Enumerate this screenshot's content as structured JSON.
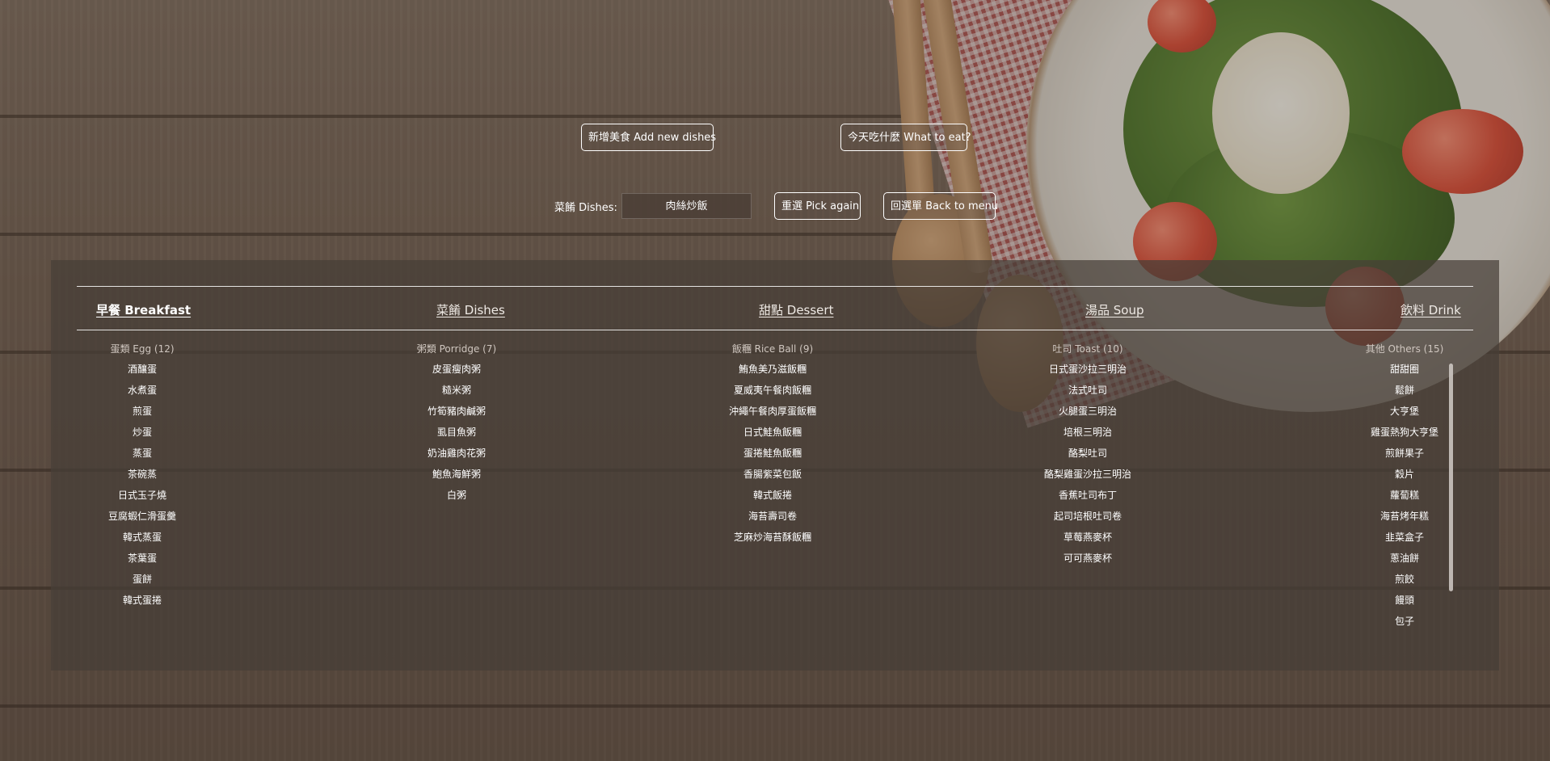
{
  "theme": {
    "accent": "#ffffff",
    "panel": "#463e38",
    "wood": "#6f5c4e"
  },
  "buttons": {
    "add_new": "新增美食 Add new dishes",
    "what_to_eat": "今天吃什麼 What to eat?",
    "pick_again": "重選 Pick again",
    "back_to_menu": "回選單 Back to menu"
  },
  "picker": {
    "label": "菜餚 Dishes:",
    "value": "肉絲炒飯"
  },
  "tabs": [
    {
      "label": "早餐 Breakfast",
      "active": true
    },
    {
      "label": "菜餚 Dishes",
      "active": false
    },
    {
      "label": "甜點 Dessert",
      "active": false
    },
    {
      "label": "湯品 Soup",
      "active": false
    },
    {
      "label": "飲料 Drink",
      "active": false
    }
  ],
  "columns": [
    {
      "header": "蛋類 Egg (12)",
      "items": [
        "酒釀蛋",
        "水煮蛋",
        "煎蛋",
        "炒蛋",
        "蒸蛋",
        "茶碗蒸",
        "日式玉子燒",
        "豆腐蝦仁滑蛋羹",
        "韓式蒸蛋",
        "茶葉蛋",
        "蛋餅",
        "韓式蛋捲"
      ]
    },
    {
      "header": "粥類 Porridge (7)",
      "items": [
        "皮蛋瘦肉粥",
        "糙米粥",
        "竹筍豬肉鹹粥",
        "虱目魚粥",
        "奶油雞肉花粥",
        "鮑魚海鮮粥",
        "白粥"
      ]
    },
    {
      "header": "飯糰 Rice Ball (9)",
      "items": [
        "鮪魚美乃滋飯糰",
        "夏威夷午餐肉飯糰",
        "沖繩午餐肉厚蛋飯糰",
        "日式鮭魚飯糰",
        "蛋捲鮭魚飯糰",
        "香腸紫菜包飯",
        "韓式飯捲",
        "海苔壽司卷",
        "芝麻炒海苔酥飯糰"
      ]
    },
    {
      "header": "吐司 Toast (10)",
      "items": [
        "日式蛋沙拉三明治",
        "法式吐司",
        "火腿蛋三明治",
        "培根三明治",
        "酪梨吐司",
        "酪梨雞蛋沙拉三明治",
        "香蕉吐司布丁",
        "起司培根吐司卷",
        "草莓燕麥杯",
        "可可燕麥杯"
      ]
    },
    {
      "header": "其他 Others (15)",
      "items": [
        "甜甜圈",
        "鬆餅",
        "大亨堡",
        "雞蛋熱狗大亨堡",
        "煎餅果子",
        "穀片",
        "蘿蔔糕",
        "海苔烤年糕",
        "韭菜盒子",
        "蔥油餅",
        "煎餃",
        "饅頭",
        "包子"
      ]
    }
  ]
}
